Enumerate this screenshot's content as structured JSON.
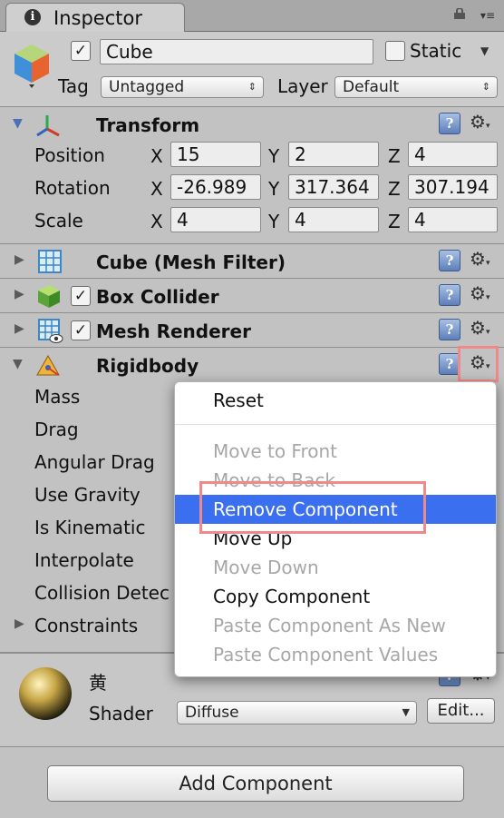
{
  "tab": {
    "title": "Inspector"
  },
  "object": {
    "name": "Cube",
    "active": true,
    "static_label": "Static",
    "static_checked": false,
    "tag_label": "Tag",
    "tag_value": "Untagged",
    "layer_label": "Layer",
    "layer_value": "Default"
  },
  "transform": {
    "title": "Transform",
    "rows": [
      {
        "label": "Position",
        "x": "15",
        "y": "2",
        "z": "4"
      },
      {
        "label": "Rotation",
        "x": "-26.989",
        "y": "317.364",
        "z": "307.194"
      },
      {
        "label": "Scale",
        "x": "4",
        "y": "4",
        "z": "4"
      }
    ]
  },
  "axes": {
    "x": "X",
    "y": "Y",
    "z": "Z"
  },
  "components": {
    "mesh_filter": "Cube (Mesh Filter)",
    "box_collider": "Box Collider",
    "mesh_renderer": "Mesh Renderer",
    "rigidbody": "Rigidbody"
  },
  "rigidbody_props": [
    "Mass",
    "Drag",
    "Angular Drag",
    "Use Gravity",
    "Is Kinematic",
    "Interpolate",
    "Collision Detec",
    "Constraints"
  ],
  "context_menu": {
    "items": [
      {
        "label": "Reset",
        "state": "enabled"
      },
      {
        "label": "Move to Front",
        "state": "disabled"
      },
      {
        "label": "Move to Back",
        "state": "disabled"
      },
      {
        "label": "Remove Component",
        "state": "selected"
      },
      {
        "label": "Move Up",
        "state": "enabled"
      },
      {
        "label": "Move Down",
        "state": "disabled"
      },
      {
        "label": "Copy Component",
        "state": "enabled"
      },
      {
        "label": "Paste Component As New",
        "state": "disabled"
      },
      {
        "label": "Paste Component Values",
        "state": "disabled"
      }
    ]
  },
  "material": {
    "name": "黄",
    "shader_label": "Shader",
    "shader_value": "Diffuse",
    "edit_label": "Edit..."
  },
  "add_component_label": "Add Component",
  "icons": {
    "help": "help-book-icon",
    "gear": "gear-icon",
    "checkmark": "✓",
    "fold_closed": "▶",
    "fold_open": "▼",
    "popup_arrows": "⇕"
  },
  "colors": {
    "selection": "#3a6ff0",
    "highlight_box": "#f08a8a",
    "panel": "#c2c2c2"
  }
}
